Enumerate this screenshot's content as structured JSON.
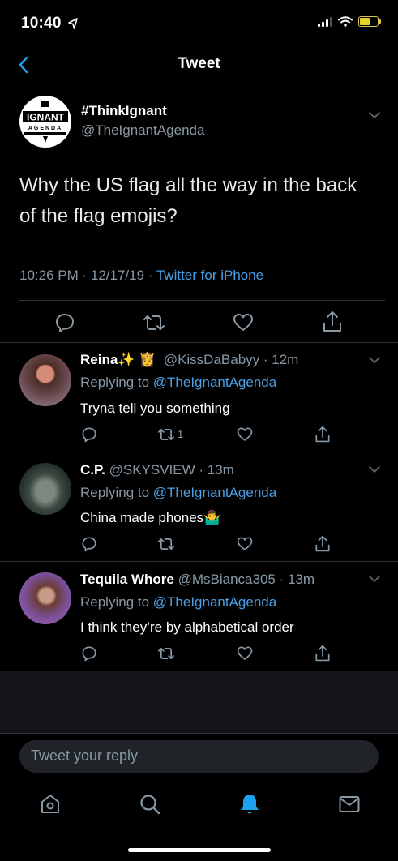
{
  "status_bar": {
    "time": "10:40"
  },
  "nav": {
    "title": "Tweet"
  },
  "main_tweet": {
    "name": "#ThinkIgnant",
    "handle": "@TheIgnantAgenda",
    "text": "Why the US flag all the way in the back of the flag emojis?",
    "time": "10:26 PM · 12/17/19 · ",
    "source": "Twitter for iPhone",
    "avatar_logo_top": "IGNANT",
    "avatar_logo_bottom": "AGENDA"
  },
  "replies": [
    {
      "name": "Reina",
      "emoji": "✨ 👸",
      "handle": "@KissDaBabyy · 12m",
      "replying_label": "Replying to ",
      "replying_to": "@TheIgnantAgenda",
      "text": "Tryna tell you something",
      "retweet_count": "1"
    },
    {
      "name": "C.P.",
      "handle": "@SKYSVIEW · 13m",
      "replying_label": "Replying to ",
      "replying_to": "@TheIgnantAgenda",
      "text": "China made phones🤷‍♂️"
    },
    {
      "name": "Tequila Whore",
      "handle": "@MsBianca305 · 13m",
      "replying_label": "Replying to ",
      "replying_to": "@TheIgnantAgenda",
      "text": "I think they’re by alphabetical order"
    }
  ],
  "composer": {
    "placeholder": "Tweet your reply"
  },
  "tab_bar": {
    "active": "notifications"
  },
  "colors": {
    "accent": "#1da1f2",
    "link": "#4b9fe6",
    "muted": "#8899a6",
    "background": "#000000"
  }
}
